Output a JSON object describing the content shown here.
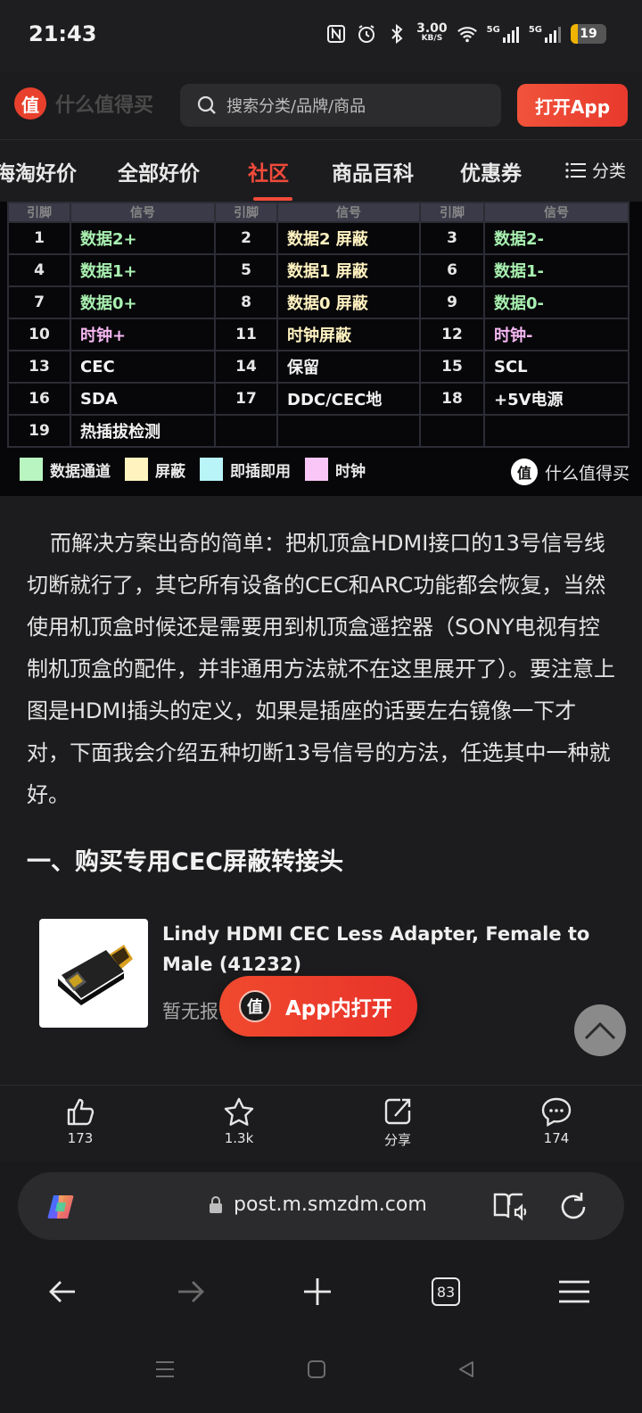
{
  "status_bar": {
    "time": "21:43",
    "net_speed_value": "3.00",
    "net_speed_unit": "KB/S",
    "signal1_label": "5G",
    "signal2_label": "5G",
    "battery_level": "19",
    "battery_fraction": 0.19
  },
  "header": {
    "logo_mark": "值",
    "logo_text": "什么值得买",
    "search_placeholder": "搜索分类/品牌/商品",
    "open_app_label": "打开App"
  },
  "tabs": {
    "items": [
      "海淘好价",
      "全部好价",
      "社区",
      "商品百科",
      "优惠券"
    ],
    "active_index": 2,
    "category_label": "分类"
  },
  "pin_table": {
    "headers": [
      "引脚",
      "信号",
      "引脚",
      "信号",
      "引脚",
      "信号"
    ],
    "rows": [
      [
        {
          "pin": "1",
          "signal": "数据2+",
          "type": "data"
        },
        {
          "pin": "2",
          "signal": "数据2 屏蔽",
          "type": "shield"
        },
        {
          "pin": "3",
          "signal": "数据2-",
          "type": "data"
        }
      ],
      [
        {
          "pin": "4",
          "signal": "数据1+",
          "type": "data"
        },
        {
          "pin": "5",
          "signal": "数据1 屏蔽",
          "type": "shield"
        },
        {
          "pin": "6",
          "signal": "数据1-",
          "type": "data"
        }
      ],
      [
        {
          "pin": "7",
          "signal": "数据0+",
          "type": "data"
        },
        {
          "pin": "8",
          "signal": "数据0 屏蔽",
          "type": "shield"
        },
        {
          "pin": "9",
          "signal": "数据0-",
          "type": "data"
        }
      ],
      [
        {
          "pin": "10",
          "signal": "时钟+",
          "type": "clock"
        },
        {
          "pin": "11",
          "signal": "时钟屏蔽",
          "type": "shield"
        },
        {
          "pin": "12",
          "signal": "时钟-",
          "type": "clock"
        }
      ],
      [
        {
          "pin": "13",
          "signal": "CEC",
          "type": "plug"
        },
        {
          "pin": "14",
          "signal": "保留",
          "type": "plug"
        },
        {
          "pin": "15",
          "signal": "SCL",
          "type": "plug"
        }
      ],
      [
        {
          "pin": "16",
          "signal": "SDA",
          "type": "plug"
        },
        {
          "pin": "17",
          "signal": "DDC/CEC地",
          "type": "plug"
        },
        {
          "pin": "18",
          "signal": "+5V电源",
          "type": "plug"
        }
      ],
      [
        {
          "pin": "19",
          "signal": "热插拔检测",
          "type": "plug"
        },
        {
          "pin": "",
          "signal": "",
          "type": "plug"
        },
        {
          "pin": "",
          "signal": "",
          "type": "plug"
        }
      ]
    ],
    "legend": [
      {
        "label": "数据通道",
        "color": "#b8f5c0"
      },
      {
        "label": "屏蔽",
        "color": "#fff4c0"
      },
      {
        "label": "即插即用",
        "color": "#b8f4f8"
      },
      {
        "label": "时钟",
        "color": "#f9c6f7"
      }
    ],
    "watermark_mark": "值",
    "watermark_text": "什么值得买"
  },
  "article": {
    "paragraph": "而解决方案出奇的简单：把机顶盒HDMI接口的13号信号线切断就行了，其它所有设备的CEC和ARC功能都会恢复，当然使用机顶盒时候还是需要用到机顶盒遥控器（SONY电视有控制机顶盒的配件，并非通用方法就不在这里展开了）。要注意上图是HDMI插头的定义，如果是插座的话要左右镜像一下才对，下面我会介绍五种切断13号信号的方法，任选其中一种就好。",
    "heading": "一、购买专用CEC屏蔽转接头"
  },
  "product": {
    "title": "Lindy HDMI CEC Less Adapter, Female to Male (41232)",
    "price": "暂无报价"
  },
  "float_button": {
    "mark": "值",
    "label": "App内打开"
  },
  "actions": {
    "like_count": "173",
    "favorite_count": "1.3k",
    "share_label": "分享",
    "comment_count": "174"
  },
  "browser": {
    "url": "post.m.smzdm.com",
    "tab_count": "83"
  }
}
